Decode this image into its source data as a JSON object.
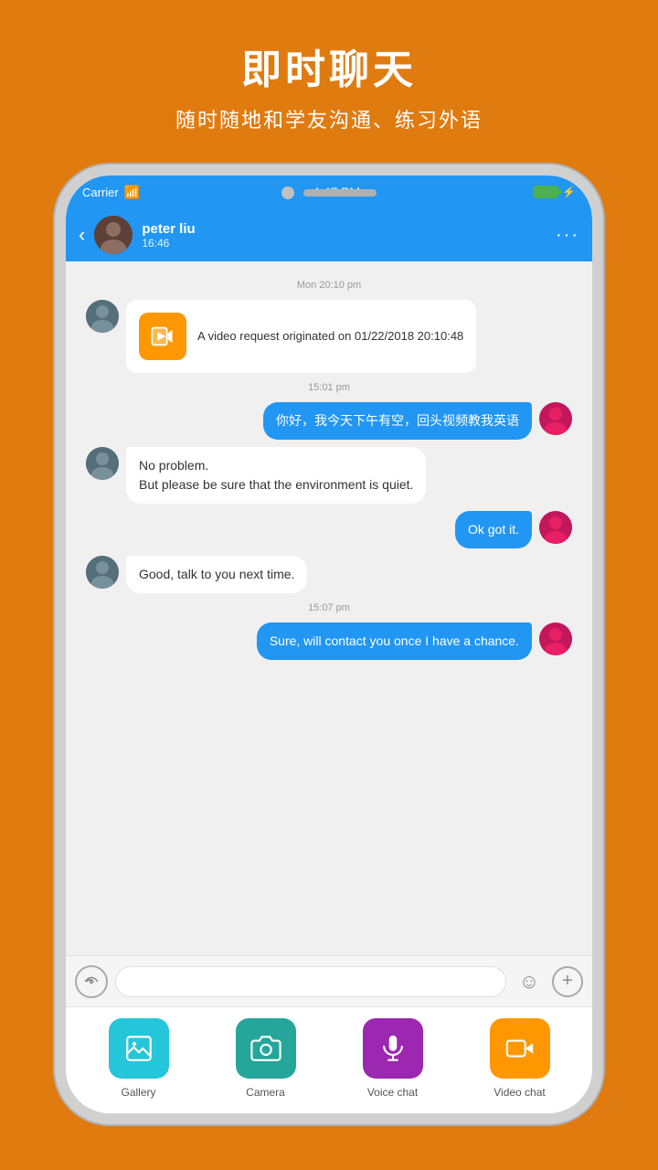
{
  "header": {
    "title": "即时聊天",
    "subtitle": "随时随地和学友沟通、练习外语"
  },
  "status_bar": {
    "carrier": "Carrier",
    "time": "4:47 PM"
  },
  "nav": {
    "contact_name": "peter liu",
    "contact_time": "16:46"
  },
  "chat": {
    "timestamps": [
      "Mon 20:10 pm",
      "15:01 pm",
      "15:07 pm"
    ],
    "messages": [
      {
        "type": "incoming",
        "kind": "video_request",
        "text": "A video request originated on 01/22/2018 20:10:48"
      },
      {
        "type": "outgoing",
        "text": "你好，我今天下午有空，回头视频教我英语"
      },
      {
        "type": "incoming",
        "text": "No  problem.\nBut  please be sure that the environment is  quiet."
      },
      {
        "type": "outgoing",
        "text": "Ok got it."
      },
      {
        "type": "incoming",
        "text": "Good, talk  to you next time."
      },
      {
        "type": "outgoing",
        "text": "Sure, will contact you once I have a chance."
      }
    ]
  },
  "input": {
    "placeholder": ""
  },
  "toolbar": {
    "items": [
      {
        "label": "Gallery",
        "icon": "gallery",
        "color": "teal"
      },
      {
        "label": "Camera",
        "icon": "camera",
        "color": "green"
      },
      {
        "label": "Voice chat",
        "icon": "voice",
        "color": "purple"
      },
      {
        "label": "Video chat",
        "icon": "video",
        "color": "orange"
      }
    ]
  }
}
